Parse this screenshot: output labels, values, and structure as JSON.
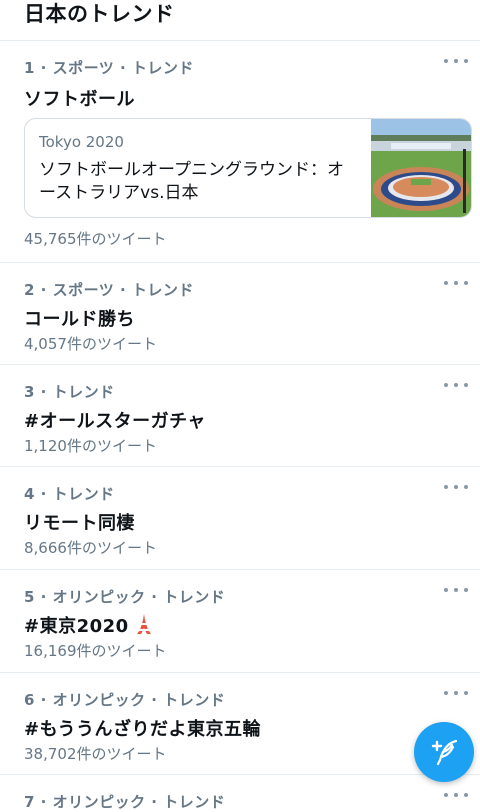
{
  "header": {
    "title": "日本のトレンド"
  },
  "trends": [
    {
      "meta": "1 · スポーツ · トレンド",
      "name": "ソフトボール",
      "card": {
        "source": "Tokyo 2020",
        "title": "ソフトボールオープニングラウンド：オーストラリアvs.日本"
      },
      "count": "45,765件のツイート"
    },
    {
      "meta": "2 · スポーツ · トレンド",
      "name": "コールド勝ち",
      "count": "4,057件のツイート"
    },
    {
      "meta": "3 · トレンド",
      "name": "#オールスターガチャ",
      "count": "1,120件のツイート"
    },
    {
      "meta": "4 · トレンド",
      "name": "リモート同棲",
      "count": "8,666件のツイート"
    },
    {
      "meta": "5 · オリンピック · トレンド",
      "name": "#東京2020",
      "count": "16,169件のツイート"
    },
    {
      "meta": "6 · オリンピック · トレンド",
      "name": "#もううんざりだよ東京五輪",
      "count": "38,702件のツイート"
    },
    {
      "meta": "7 · オリンピック · トレンド"
    }
  ],
  "colors": {
    "accent": "#1da1f2",
    "secondary_text": "#657786",
    "primary_text": "#0f1419",
    "divider": "#e6ecf0"
  },
  "icons": {
    "more": "more-horizontal-icon",
    "compose": "compose-tweet-icon",
    "tokyo_tower": "tokyo-tower-icon"
  }
}
